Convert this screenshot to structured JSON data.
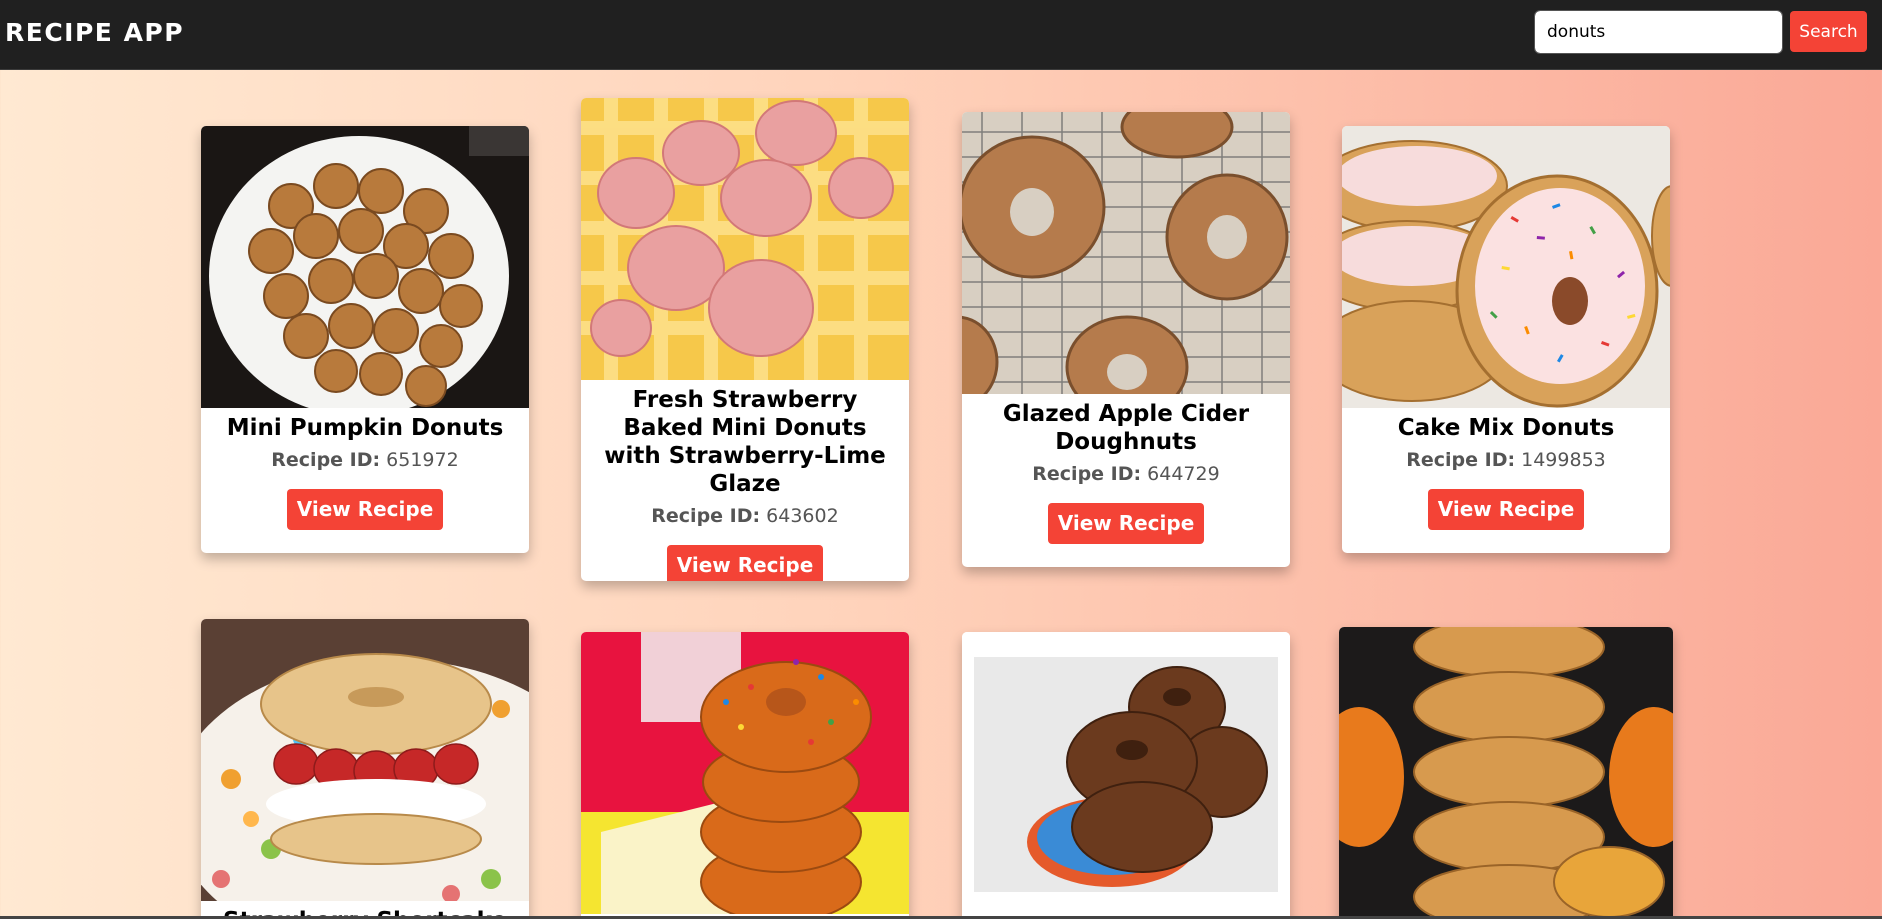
{
  "app": {
    "title": "RECIPE APP"
  },
  "search": {
    "value": "donuts",
    "button_label": "Search"
  },
  "id_label": "Recipe ID:",
  "view_label": "View Recipe",
  "recipes": [
    {
      "title": "Mini Pumpkin Donuts",
      "id": "651972"
    },
    {
      "title": "Fresh Strawberry Baked Mini Donuts with Strawberry-Lime Glaze",
      "id": "643602"
    },
    {
      "title": "Glazed Apple Cider Doughnuts",
      "id": "644729"
    },
    {
      "title": "Cake Mix Donuts",
      "id": "1499853"
    },
    {
      "title": "Strawberry Shortcake",
      "id": ""
    },
    {
      "title": "",
      "id": ""
    },
    {
      "title": "",
      "id": ""
    },
    {
      "title": "",
      "id": ""
    }
  ]
}
